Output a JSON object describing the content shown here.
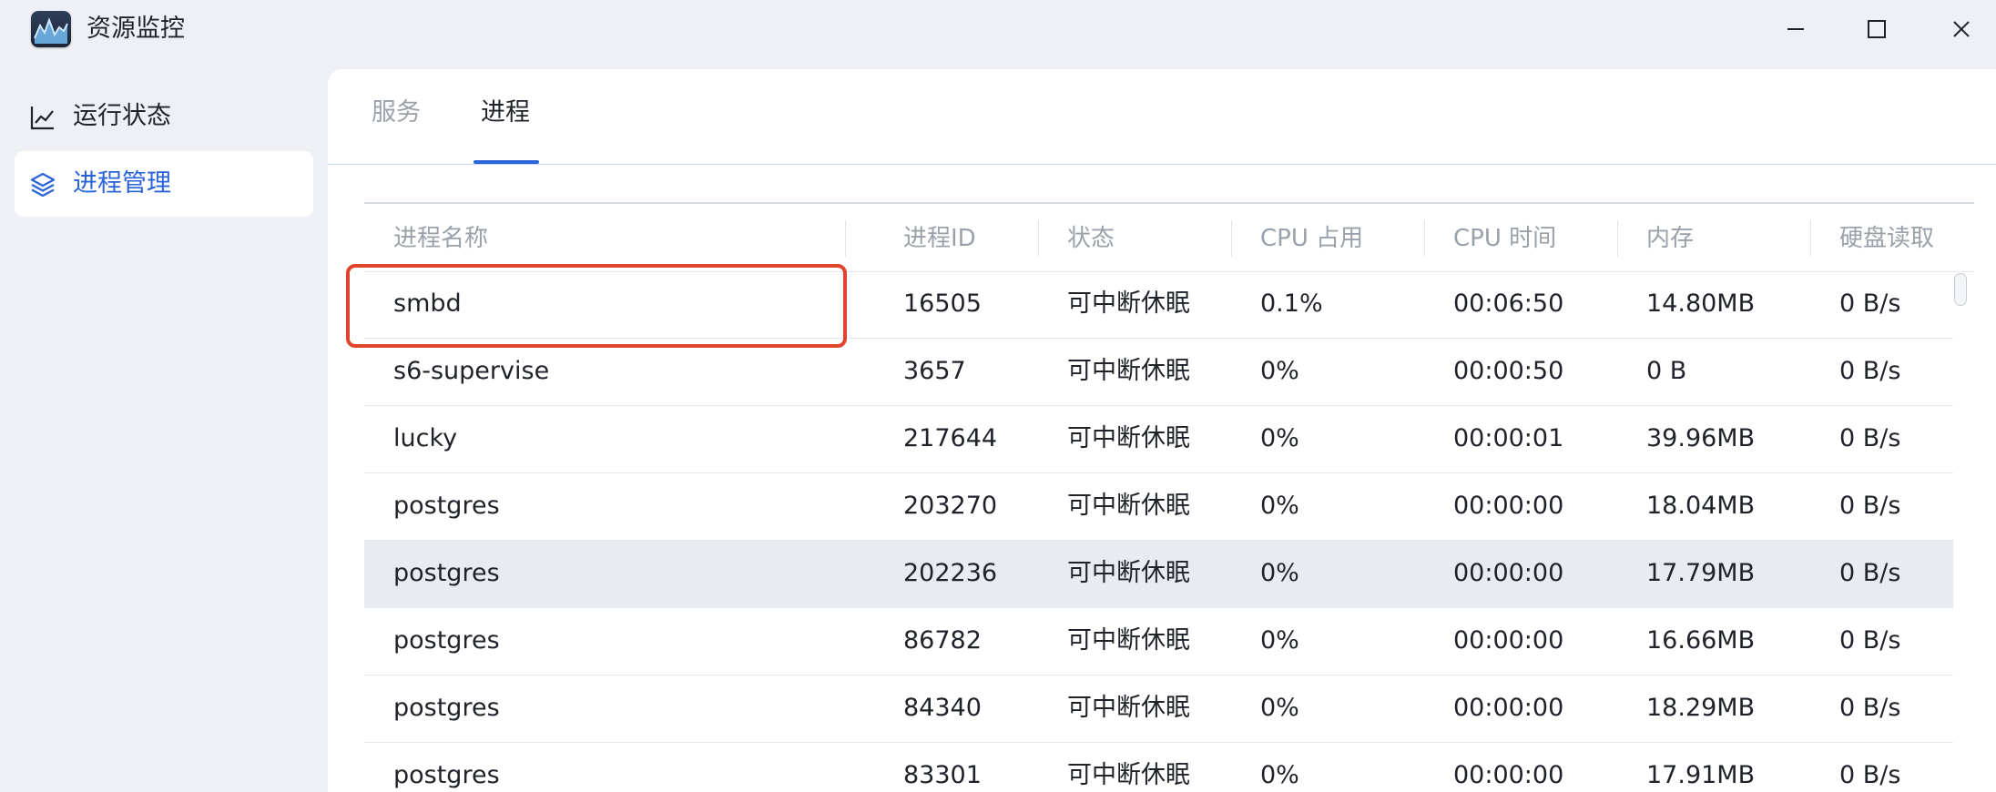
{
  "app": {
    "title": "资源监控",
    "icon": "activity-monitor-app-icon"
  },
  "window_controls": {
    "minimize_icon": "minimize-icon",
    "maximize_icon": "maximize-icon",
    "close_icon": "close-icon"
  },
  "sidebar": {
    "items": [
      {
        "label": "运行状态",
        "icon": "line-chart-icon",
        "active": false
      },
      {
        "label": "进程管理",
        "icon": "layers-icon",
        "active": true
      }
    ]
  },
  "tabs": [
    {
      "label": "服务",
      "active": false
    },
    {
      "label": "进程",
      "active": true
    }
  ],
  "table": {
    "columns": [
      "进程名称",
      "进程ID",
      "状态",
      "CPU 占用",
      "CPU 时间",
      "内存",
      "硬盘读取"
    ],
    "rows": [
      {
        "name": "smbd",
        "pid": "16505",
        "status": "可中断休眠",
        "cpu": "0.1%",
        "cpu_time": "00:06:50",
        "memory": "14.80MB",
        "disk_read": "0 B/s",
        "highlighted": true
      },
      {
        "name": "s6-supervise",
        "pid": "3657",
        "status": "可中断休眠",
        "cpu": "0%",
        "cpu_time": "00:00:50",
        "memory": "0 B",
        "disk_read": "0 B/s"
      },
      {
        "name": "lucky",
        "pid": "217644",
        "status": "可中断休眠",
        "cpu": "0%",
        "cpu_time": "00:00:01",
        "memory": "39.96MB",
        "disk_read": "0 B/s"
      },
      {
        "name": "postgres",
        "pid": "203270",
        "status": "可中断休眠",
        "cpu": "0%",
        "cpu_time": "00:00:00",
        "memory": "18.04MB",
        "disk_read": "0 B/s"
      },
      {
        "name": "postgres",
        "pid": "202236",
        "status": "可中断休眠",
        "cpu": "0%",
        "cpu_time": "00:00:00",
        "memory": "17.79MB",
        "disk_read": "0 B/s",
        "hovered": true
      },
      {
        "name": "postgres",
        "pid": "86782",
        "status": "可中断休眠",
        "cpu": "0%",
        "cpu_time": "00:00:00",
        "memory": "16.66MB",
        "disk_read": "0 B/s"
      },
      {
        "name": "postgres",
        "pid": "84340",
        "status": "可中断休眠",
        "cpu": "0%",
        "cpu_time": "00:00:00",
        "memory": "18.29MB",
        "disk_read": "0 B/s"
      },
      {
        "name": "postgres",
        "pid": "83301",
        "status": "可中断休眠",
        "cpu": "0%",
        "cpu_time": "00:00:00",
        "memory": "17.91MB",
        "disk_read": "0 B/s"
      }
    ]
  },
  "colors": {
    "accent": "#2a63d8",
    "highlight_border": "#e0442f",
    "hover_row": "#e8ebef",
    "sidebar_bg": "#eef0f5"
  }
}
